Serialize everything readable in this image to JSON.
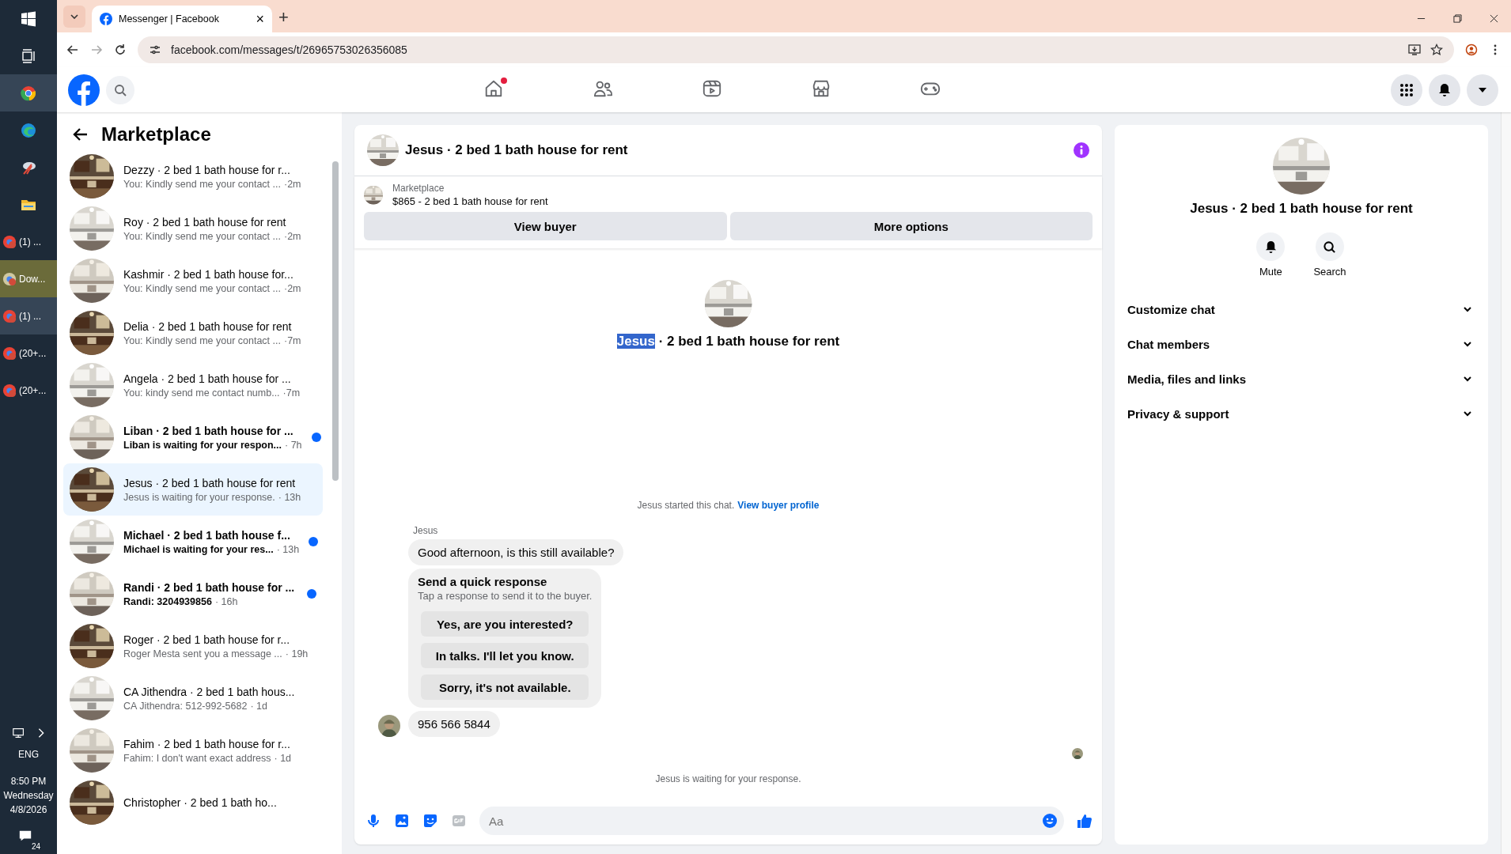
{
  "taskbar": {
    "apps": [
      {
        "kind": "windows",
        "active": false
      },
      {
        "kind": "taskview",
        "active": false
      },
      {
        "kind": "chrome",
        "active": true
      },
      {
        "kind": "edge",
        "active": false
      },
      {
        "kind": "snip",
        "active": false
      },
      {
        "kind": "folder",
        "active": false
      }
    ],
    "windows": [
      {
        "label": "(1) ...",
        "active": false,
        "highlight": false
      },
      {
        "label": "Dow...",
        "active": false,
        "highlight": true
      },
      {
        "label": "(1) ...",
        "active": true,
        "highlight": false
      },
      {
        "label": "(20+...",
        "active": false,
        "highlight": false
      },
      {
        "label": "(20+...",
        "active": false,
        "highlight": false
      }
    ],
    "language": "ENG",
    "time": "8:50 PM",
    "day": "Wednesday",
    "date": "4/8/2026",
    "notifications": "24"
  },
  "browser": {
    "tab_title": "Messenger | Facebook",
    "tab_close": "×",
    "new_tab": "+",
    "url": "facebook.com/messages/t/26965753026356085"
  },
  "nav": {
    "tabs": [
      {
        "kind": "home",
        "selected": false,
        "badge": true
      },
      {
        "kind": "friends",
        "selected": false,
        "badge": false
      },
      {
        "kind": "video",
        "selected": false,
        "badge": false
      },
      {
        "kind": "market",
        "selected": false,
        "badge": false
      },
      {
        "kind": "gaming",
        "selected": false,
        "badge": false
      }
    ]
  },
  "sidebar": {
    "title": "Marketplace",
    "conversations": [
      {
        "title": "Dezzy · 2 bed 1 bath house for r...",
        "preview": "You: Kindly send me your contact ...",
        "time": "·2m",
        "unread": false,
        "selected": false
      },
      {
        "title": "Roy · 2 bed 1 bath house for rent",
        "preview": "You: Kindly send me your contact ...",
        "time": "·2m",
        "unread": false,
        "selected": false
      },
      {
        "title": "Kashmir · 2 bed 1 bath house for...",
        "preview": "You: Kindly send me your contact ...",
        "time": "·2m",
        "unread": false,
        "selected": false
      },
      {
        "title": "Delia · 2 bed 1 bath house for rent",
        "preview": "You: Kindly send me your contact ...",
        "time": "·7m",
        "unread": false,
        "selected": false
      },
      {
        "title": "Angela · 2 bed 1 bath house for ...",
        "preview": "You: kindy send me contact numb...",
        "time": "·7m",
        "unread": false,
        "selected": false
      },
      {
        "title": "Liban · 2 bed 1 bath house for ...",
        "preview": "Liban is waiting for your respon...",
        "time": "· 7h",
        "unread": true,
        "selected": false
      },
      {
        "title": "Jesus · 2 bed 1 bath house for rent",
        "preview": "Jesus is waiting for your response.",
        "time": "· 13h",
        "unread": false,
        "selected": true
      },
      {
        "title": "Michael · 2 bed 1 bath house f...",
        "preview": "Michael is waiting for your res...",
        "time": "· 13h",
        "unread": true,
        "selected": false
      },
      {
        "title": "Randi · 2 bed 1 bath house for ...",
        "preview": "Randi: 3204939856",
        "time": "· 16h",
        "unread": true,
        "selected": false
      },
      {
        "title": "Roger · 2 bed 1 bath house for r...",
        "preview": "Roger Mesta sent you a message ...",
        "time": "· 19h",
        "unread": false,
        "selected": false
      },
      {
        "title": "CA Jithendra · 2 bed 1 bath hous...",
        "preview": "CA Jithendra: 512-992-5682",
        "time": "· 1d",
        "unread": false,
        "selected": false
      },
      {
        "title": "Fahim · 2 bed 1 bath house for r...",
        "preview": "Fahim: I don't want exact address",
        "time": "· 1d",
        "unread": false,
        "selected": false
      },
      {
        "title": "Christopher · 2 bed 1 bath ho...",
        "unread": false,
        "selected": false
      }
    ]
  },
  "chat": {
    "title": "Jesus · 2 bed 1 bath house for rent",
    "listing": {
      "source": "Marketplace",
      "item": "$865 - 2 bed 1 bath house for rent",
      "buttons": [
        "View buyer",
        "More options"
      ]
    },
    "intro": {
      "highlighted": "Jesus",
      "rest": "· 2 bed 1 bath house for rent"
    },
    "started": {
      "text": "Jesus started this chat.",
      "link": "View buyer profile"
    },
    "sender": "Jesus",
    "message": "Good afternoon, is this still available?",
    "quick_response": {
      "title": "Send a quick response",
      "subtitle": "Tap a response to send it to the buyer.",
      "options": [
        "Yes, are you interested?",
        "In talks. I'll let you know.",
        "Sorry, it's not available."
      ]
    },
    "reply": "956 566 5844",
    "status": "Jesus is waiting for your response.",
    "composer": {
      "placeholder": "Aa"
    }
  },
  "details": {
    "title": "Jesus · 2 bed 1 bath house for rent",
    "actions": [
      {
        "kind": "mute",
        "label": "Mute"
      },
      {
        "kind": "search",
        "label": "Search"
      }
    ],
    "sections": [
      {
        "label": "Customize chat",
        "expanded": false
      },
      {
        "label": "Chat members",
        "expanded": false
      },
      {
        "label": "Media, files and links",
        "expanded": false
      },
      {
        "label": "Privacy & support",
        "expanded": false
      }
    ]
  }
}
